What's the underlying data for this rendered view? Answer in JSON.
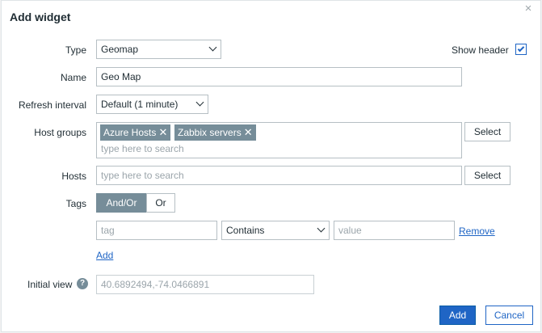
{
  "dialog": {
    "title": "Add widget",
    "close_glyph": "×"
  },
  "type_row": {
    "label": "Type",
    "value": "Geomap"
  },
  "show_header": {
    "label": "Show header",
    "checked": true
  },
  "name_row": {
    "label": "Name",
    "value": "Geo Map"
  },
  "refresh_row": {
    "label": "Refresh interval",
    "value": "Default (1 minute)"
  },
  "host_groups": {
    "label": "Host groups",
    "chips": [
      "Azure Hosts",
      "Zabbix servers"
    ],
    "remove_glyph": "✕",
    "placeholder": "type here to search",
    "select_label": "Select"
  },
  "hosts": {
    "label": "Hosts",
    "placeholder": "type here to search",
    "select_label": "Select"
  },
  "tags": {
    "label": "Tags",
    "operators": [
      "And/Or",
      "Or"
    ],
    "active_operator": "And/Or",
    "tag_placeholder": "tag",
    "condition": "Contains",
    "value_placeholder": "value",
    "remove_label": "Remove",
    "add_label": "Add"
  },
  "initial_view": {
    "label": "Initial view",
    "placeholder": "40.6892494,-74.0466891",
    "help_glyph": "?"
  },
  "footer": {
    "add_label": "Add",
    "cancel_label": "Cancel"
  },
  "colors": {
    "accent": "#1f65c5",
    "chip": "#768d99"
  }
}
